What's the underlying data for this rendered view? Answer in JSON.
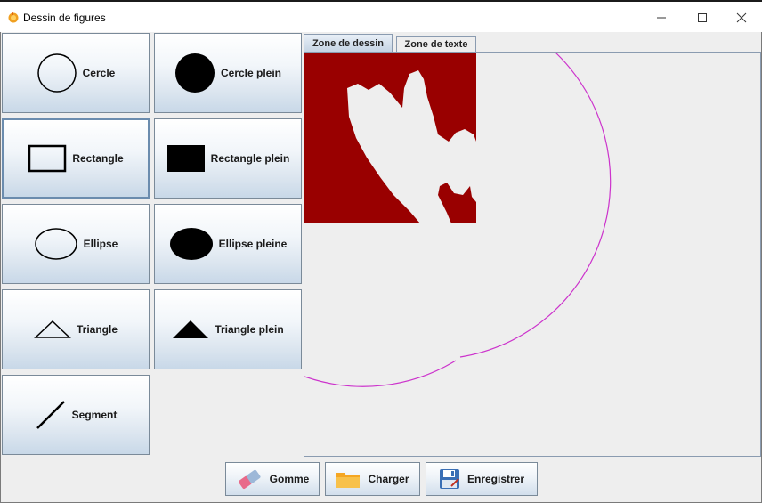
{
  "window": {
    "title": "Dessin de figures"
  },
  "shapes": [
    {
      "label": "Cercle",
      "icon": "circle-outline-icon"
    },
    {
      "label": "Cercle plein",
      "icon": "circle-filled-icon"
    },
    {
      "label": "Rectangle",
      "icon": "rectangle-outline-icon"
    },
    {
      "label": "Rectangle plein",
      "icon": "rectangle-filled-icon"
    },
    {
      "label": "Ellipse",
      "icon": "ellipse-outline-icon"
    },
    {
      "label": "Ellipse pleine",
      "icon": "ellipse-filled-icon"
    },
    {
      "label": "Triangle",
      "icon": "triangle-outline-icon"
    },
    {
      "label": "Triangle plein",
      "icon": "triangle-filled-icon"
    },
    {
      "label": "Segment",
      "icon": "segment-icon"
    }
  ],
  "tabs": [
    {
      "label": "Zone de dessin",
      "selected": true
    },
    {
      "label": "Zone de texte",
      "selected": false
    }
  ],
  "canvas": {
    "fill_color": "#990000",
    "circle_color": "#cc33cc"
  },
  "actions": {
    "eraser": "Gomme",
    "load": "Charger",
    "save": "Enregistrer"
  }
}
